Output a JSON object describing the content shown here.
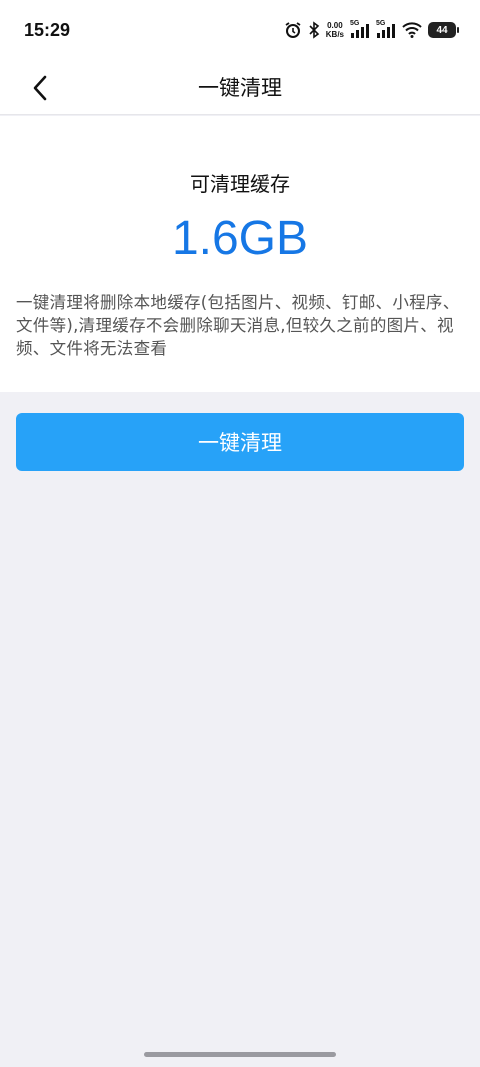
{
  "status_bar": {
    "time": "15:29",
    "net_speed_value": "0.00",
    "net_speed_unit": "KB/s",
    "signal1_label": "5G",
    "signal2_label": "5G",
    "battery": "44"
  },
  "nav": {
    "title": "一键清理",
    "back_icon": "chevron-left-icon"
  },
  "card": {
    "heading": "可清理缓存",
    "size": "1.6GB",
    "description": "一键清理将删除本地缓存(包括图片、视频、钉邮、小程序、文件等),清理缓存不会删除聊天消息,但较久之前的图片、视频、文件将无法查看"
  },
  "action": {
    "button_label": "一键清理"
  },
  "colors": {
    "accent": "#1677e5",
    "button": "#27a2f8",
    "background": "#f0f0f5"
  }
}
